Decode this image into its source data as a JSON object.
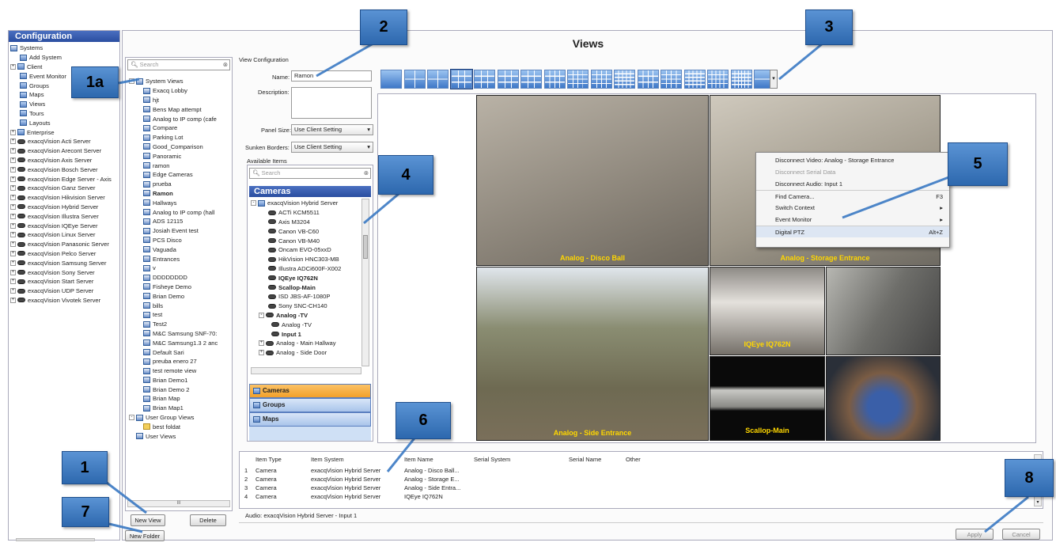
{
  "sidebar": {
    "title": "Configuration",
    "items": [
      {
        "label": "Systems",
        "icon": "systems-icon",
        "depth": 0,
        "exp": "",
        "icls": "sv"
      },
      {
        "label": "Add System",
        "icon": "add-system-icon",
        "depth": 1,
        "exp": "",
        "icls": ""
      },
      {
        "label": "Client",
        "icon": "client-icon",
        "depth": 0,
        "exp": "+",
        "icls": ""
      },
      {
        "label": "Event Monitor",
        "icon": "event-monitor-icon",
        "depth": 1,
        "exp": "",
        "icls": ""
      },
      {
        "label": "Groups",
        "icon": "groups-icon",
        "depth": 1,
        "exp": "",
        "icls": ""
      },
      {
        "label": "Maps",
        "icon": "maps-icon",
        "depth": 1,
        "exp": "",
        "icls": ""
      },
      {
        "label": "Views",
        "icon": "views-icon",
        "depth": 1,
        "exp": "",
        "icls": ""
      },
      {
        "label": "Tours",
        "icon": "tours-icon",
        "depth": 1,
        "exp": "",
        "icls": ""
      },
      {
        "label": "Layouts",
        "icon": "layouts-icon",
        "depth": 1,
        "exp": "",
        "icls": ""
      },
      {
        "label": "Enterprise",
        "icon": "enterprise-icon",
        "depth": 0,
        "exp": "+",
        "icls": ""
      },
      {
        "label": "exacqVision Acti Server",
        "icon": "server-icon",
        "depth": 0,
        "exp": "+",
        "icls": "cam"
      },
      {
        "label": "exacqVision Arecont Server",
        "icon": "server-icon",
        "depth": 0,
        "exp": "+",
        "icls": "cam"
      },
      {
        "label": "exacqVision Axis Server",
        "icon": "server-icon",
        "depth": 0,
        "exp": "+",
        "icls": "cam"
      },
      {
        "label": "exacqVision Bosch Server",
        "icon": "server-icon",
        "depth": 0,
        "exp": "+",
        "icls": "cam"
      },
      {
        "label": "exacqVision Edge Server - Axis",
        "icon": "server-icon",
        "depth": 0,
        "exp": "+",
        "icls": "cam"
      },
      {
        "label": "exacqVision Ganz Server",
        "icon": "server-icon",
        "depth": 0,
        "exp": "+",
        "icls": "cam"
      },
      {
        "label": "exacqVision Hikvision Server",
        "icon": "server-icon",
        "depth": 0,
        "exp": "+",
        "icls": "cam"
      },
      {
        "label": "exacqVision Hybrid Server",
        "icon": "server-icon",
        "depth": 0,
        "exp": "+",
        "icls": "cam"
      },
      {
        "label": "exacqVision Illustra Server",
        "icon": "server-icon",
        "depth": 0,
        "exp": "+",
        "icls": "cam"
      },
      {
        "label": "exacqVision IQEye Server",
        "icon": "server-icon",
        "depth": 0,
        "exp": "+",
        "icls": "cam"
      },
      {
        "label": "exacqVision Linux Server",
        "icon": "server-icon",
        "depth": 0,
        "exp": "+",
        "icls": "cam"
      },
      {
        "label": "exacqVision Panasonic Server",
        "icon": "server-icon",
        "depth": 0,
        "exp": "+",
        "icls": "cam"
      },
      {
        "label": "exacqVision Pelco Server",
        "icon": "server-icon",
        "depth": 0,
        "exp": "+",
        "icls": "cam"
      },
      {
        "label": "exacqVision Samsung Server",
        "icon": "server-icon",
        "depth": 0,
        "exp": "+",
        "icls": "cam"
      },
      {
        "label": "exacqVision Sony Server",
        "icon": "server-icon",
        "depth": 0,
        "exp": "+",
        "icls": "cam"
      },
      {
        "label": "exacqVision Start Server",
        "icon": "server-icon",
        "depth": 0,
        "exp": "+",
        "icls": "cam"
      },
      {
        "label": "exacqVision UDP Server",
        "icon": "server-icon",
        "depth": 0,
        "exp": "+",
        "icls": "cam"
      },
      {
        "label": "exacqVision Vivotek Server",
        "icon": "server-icon",
        "depth": 0,
        "exp": "+",
        "icls": "cam"
      }
    ]
  },
  "title": "Views",
  "search_placeholder": "Search",
  "views": {
    "root": "System Views",
    "items": [
      "Exacq Lobby",
      "hjt",
      "Bens Map attempt",
      "Analog to IP comp (cafe",
      "Compare",
      "Parking Lot",
      "Good_Comparison",
      "Panoramic",
      "ramon",
      "Edge Cameras",
      "prueba",
      "Ramon",
      "Hallways",
      "Analog to IP comp (hall",
      "ADS 12115",
      "Josiah Event test",
      "PCS Disco",
      "Vaguada",
      "Entrances",
      "v",
      "DDDDDDDD",
      "Fisheye Demo",
      "Brian Demo",
      "bills",
      "test",
      "Test2",
      "M&C Samsung SNF-70:",
      "M&C Samsung1.3 2 anc",
      "Default Sari",
      "preuba enero 27",
      "test remote view",
      "Brian Demo1",
      "Brian Demo 2",
      "Brian Map",
      "Brian Map1"
    ],
    "user_group": "User Group Views",
    "folder": "best foldat",
    "user": "User Views",
    "scroll_glyph": "III"
  },
  "buttons": {
    "new_view": "New View",
    "delete": "Delete",
    "new_folder": "New Folder",
    "apply": "Apply",
    "cancel": "Cancel"
  },
  "form": {
    "section": "View Configuration",
    "name_label": "Name:",
    "name_value": "Ramon",
    "desc_label": "Description:",
    "panel_label": "Panel Size:",
    "panel_value": "Use Client Setting",
    "sunken_label": "Sunken Borders:",
    "sunken_value": "Use Client Setting",
    "available": "Available Items"
  },
  "cameras": {
    "header": "Cameras",
    "server": "exacqVision Hybrid Server",
    "items": [
      {
        "label": "ACTi KCM5511",
        "bold": false,
        "depth": 2
      },
      {
        "label": "Axis M3204",
        "bold": false,
        "depth": 2
      },
      {
        "label": "Canon VB-C60",
        "bold": false,
        "depth": 2
      },
      {
        "label": "Canon VB-M40",
        "bold": false,
        "depth": 2
      },
      {
        "label": "Oncam EVO-05xxD",
        "bold": false,
        "depth": 2
      },
      {
        "label": "HikVision HNC303-MB",
        "bold": false,
        "depth": 2
      },
      {
        "label": "Illustra ADCi600F-X002",
        "bold": false,
        "depth": 2
      },
      {
        "label": "IQEye IQ762N",
        "bold": true,
        "depth": 2
      },
      {
        "label": "Scallop-Main",
        "bold": true,
        "depth": 2
      },
      {
        "label": "ISD JBS-AF-1080P",
        "bold": false,
        "depth": 2
      },
      {
        "label": "Sony SNC-CH140",
        "bold": false,
        "depth": 2
      },
      {
        "label": "Analog -TV",
        "bold": true,
        "depth": 1
      },
      {
        "label": "Analog -TV",
        "bold": false,
        "depth": 3
      },
      {
        "label": "Input 1",
        "bold": true,
        "depth": 3
      },
      {
        "label": "Analog - Main Hallway",
        "bold": false,
        "depth": 1
      },
      {
        "label": "Analog - Side Door",
        "bold": false,
        "depth": 1
      }
    ],
    "tabs": [
      "Cameras",
      "Groups",
      "Maps"
    ]
  },
  "grid": {
    "labels": [
      "Analog - Disco Ball",
      "Analog - Storage Entrance",
      "Analog - Side Entrance",
      "IQEye IQ762N",
      "",
      "Scallop-Main",
      ""
    ]
  },
  "context_menu": [
    {
      "label": "Disconnect Video: Analog - Storage Entrance",
      "shortcut": "",
      "disabled": false
    },
    {
      "label": "Disconnect Serial Data",
      "shortcut": "",
      "disabled": true
    },
    {
      "label": "Disconnect Audio: Input 1",
      "shortcut": "",
      "disabled": false
    },
    {
      "label": "Find Camera...",
      "shortcut": "F3",
      "disabled": false
    },
    {
      "label": "Switch Context",
      "shortcut": "▸",
      "disabled": false
    },
    {
      "label": "Event Monitor",
      "shortcut": "▸",
      "disabled": false
    },
    {
      "label": "Digital PTZ",
      "shortcut": "Alt+Z",
      "disabled": false
    }
  ],
  "table": {
    "headers": [
      "Item Type",
      "Item System",
      "Item Name",
      "Serial System",
      "Serial Name",
      "Other"
    ],
    "rows": [
      [
        "1",
        "Camera",
        "exacqVision Hybrid Server",
        "Analog - Disco Ball..."
      ],
      [
        "2",
        "Camera",
        "exacqVision Hybrid Server",
        "Analog - Storage E..."
      ],
      [
        "3",
        "Camera",
        "exacqVision Hybrid Server",
        "Analog - Side Entra..."
      ],
      [
        "4",
        "Camera",
        "exacqVision Hybrid Server",
        "IQEye IQ762N"
      ]
    ]
  },
  "audio": "Audio:   exacqVision Hybrid Server - Input 1",
  "callouts": [
    "1a",
    "2",
    "3",
    "4",
    "5",
    "6",
    "1",
    "7",
    "8"
  ],
  "colors": {
    "callout": "#3a79c3",
    "header": "#2a4ea0",
    "tabs": "#f3a02a"
  }
}
